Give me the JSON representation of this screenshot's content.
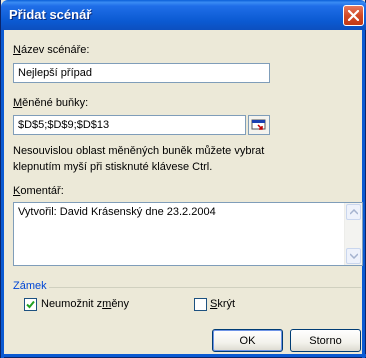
{
  "dialog": {
    "title": "Přidat scénář"
  },
  "scenario_name": {
    "label_accel": "N",
    "label_rest": "ázev scénáře:",
    "value": "Nejlepší případ"
  },
  "changing_cells": {
    "label_accel": "M",
    "label_rest": "ěněné buňky:",
    "value": "$D$5;$D$9;$D$13",
    "hint_line1": "Nesouvislou oblast měněných buněk můžete vybrat",
    "hint_line2": "klepnutím myší při stisknuté klávese Ctrl."
  },
  "comment": {
    "label_accel": "K",
    "label_rest": "omentář:",
    "value": "Vytvořil: David Krásenský dne 23.2.2004"
  },
  "protection": {
    "group_label": "Zámek",
    "prevent_changes": {
      "label_before": "Neumožnit z",
      "label_accel": "m",
      "label_after": "ěny",
      "checked": true
    },
    "hide": {
      "label_accel": "S",
      "label_rest": "krýt",
      "checked": false
    }
  },
  "buttons": {
    "ok": "OK",
    "cancel": "Storno"
  },
  "icons": {
    "close": "close-icon",
    "collapse_dialog": "collapse-dialog-icon",
    "scroll_up": "scroll-up-arrow-icon",
    "scroll_down": "scroll-down-arrow-icon",
    "checkmark": "checkmark-icon"
  },
  "colors": {
    "titlebar": "#0b5ad2",
    "dialog_bg": "#ece9d8",
    "group_label": "#0046d5",
    "close_button": "#d24a26"
  }
}
